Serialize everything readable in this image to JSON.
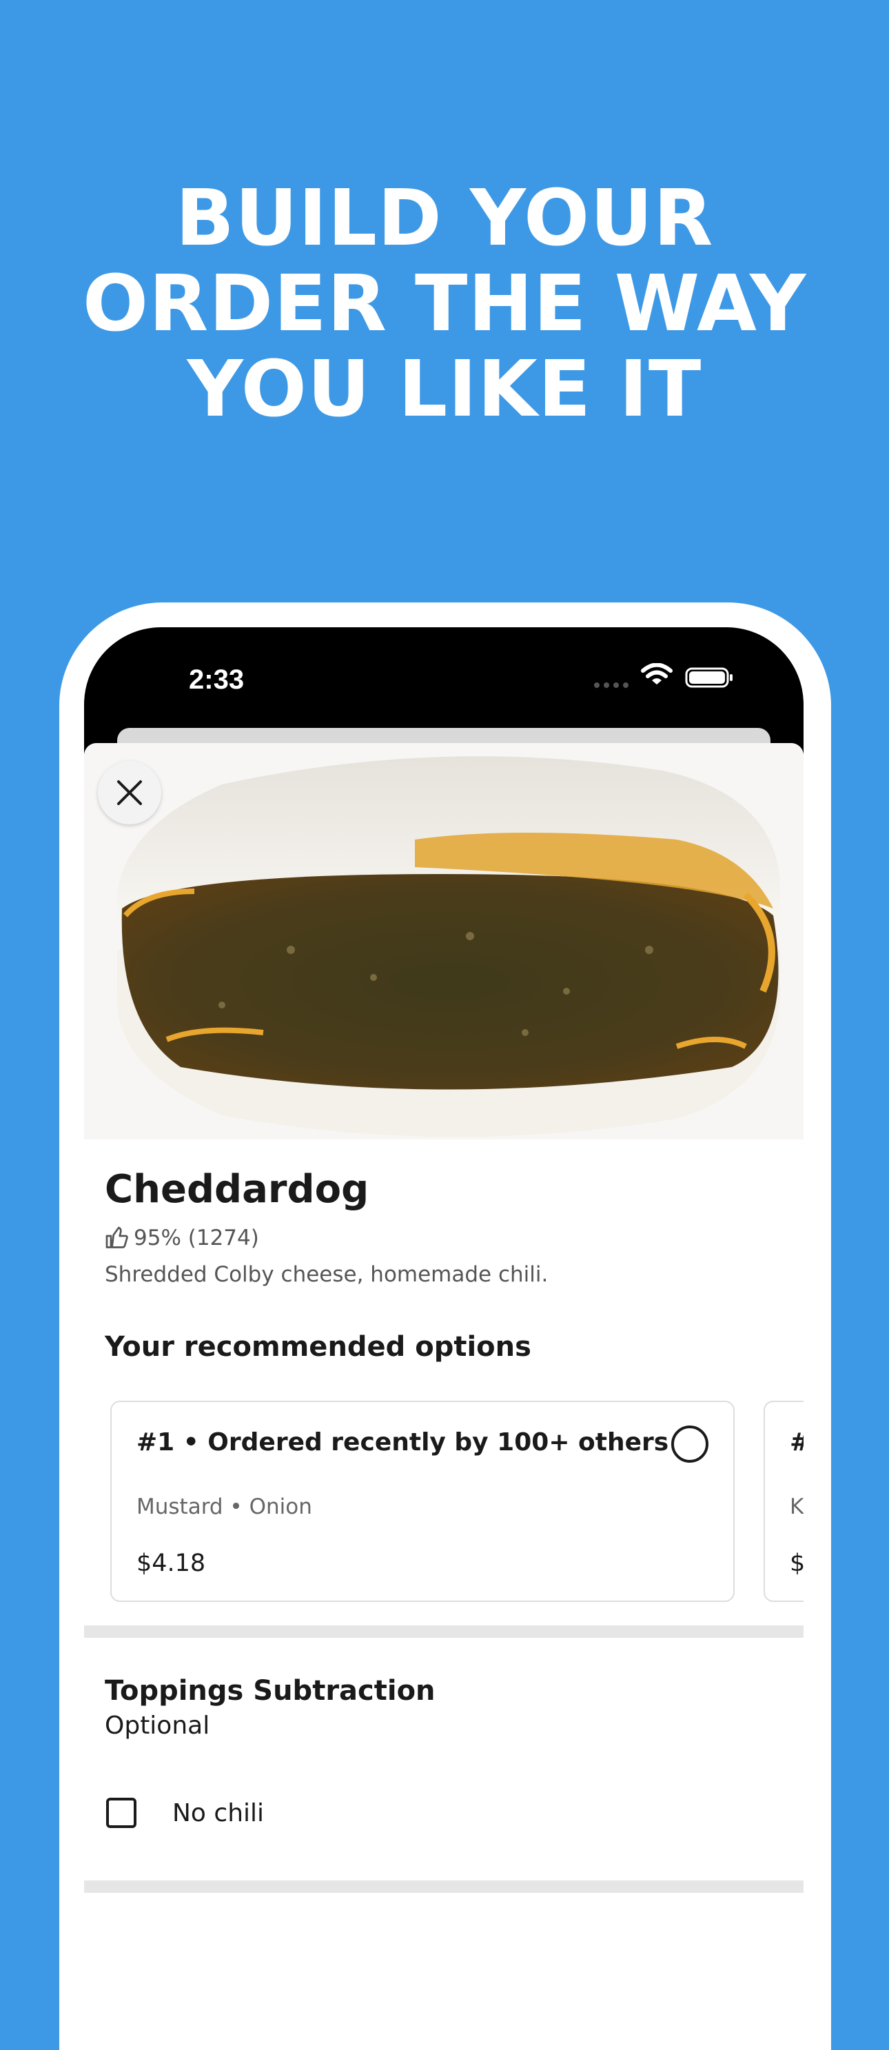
{
  "promo": {
    "headline_lines": [
      "BUILD YOUR",
      "ORDER THE WAY",
      "YOU LIKE IT"
    ]
  },
  "status_bar": {
    "time": "2:33"
  },
  "item": {
    "title": "Cheddardog",
    "rating": "95% (1274)",
    "description": "Shredded Colby cheese, homemade chili."
  },
  "recommended": {
    "heading": "Your recommended options",
    "options": [
      {
        "title": "#1 • Ordered recently by 100+ others",
        "detail": "Mustard • Onion",
        "price": "$4.18",
        "selected": false
      },
      {
        "title": "#",
        "detail": "K",
        "price": "$",
        "selected": false
      }
    ]
  },
  "toppings_subtraction": {
    "title": "Toppings Subtraction",
    "subtitle": "Optional",
    "choices": [
      {
        "label": "No chili",
        "checked": false
      }
    ]
  },
  "colors": {
    "background": "#3d99e6",
    "text_primary": "#1a1a1a",
    "text_secondary": "#555555"
  }
}
